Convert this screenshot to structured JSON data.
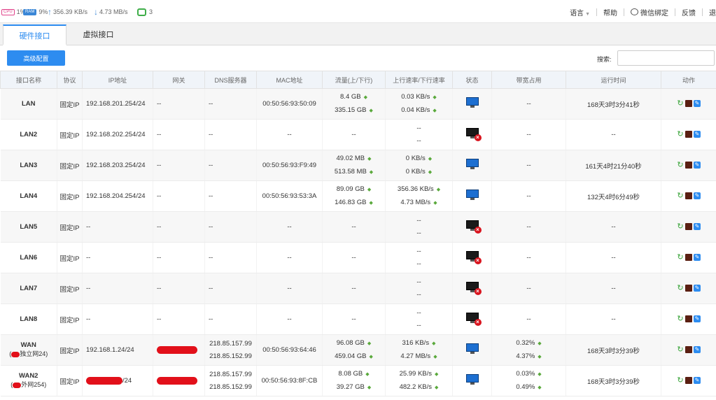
{
  "status": {
    "cpu_chip": "CPU",
    "cpu": "1%",
    "ram_chip": "RAM",
    "ram": "9%",
    "upload": "356.39 KB/s",
    "download": "4.73 MB/s",
    "devices": "3"
  },
  "toplinks": {
    "language": "语言",
    "help": "帮助",
    "wechat": "微信绑定",
    "feedback": "反馈",
    "logout": "退"
  },
  "tabs": {
    "hardware": "硬件接口",
    "virtual": "虚拟接口"
  },
  "toolbar": {
    "advanced": "高级配置",
    "search_label": "搜索:",
    "search_value": ""
  },
  "columns": [
    "接口名称",
    "协议",
    "IP地址",
    "网关",
    "DNS服务器",
    "MAC地址",
    "流量(上/下行)",
    "上行速率/下行速率",
    "状态",
    "带宽占用",
    "运行时间",
    "动作"
  ],
  "rows": [
    {
      "name": "LAN",
      "proto": "固定IP",
      "ip": "192.168.201.254/24",
      "gw": "--",
      "dns1": "--",
      "dns2": "",
      "mac": "00:50:56:93:50:09",
      "t_up": "8.4 GB",
      "t_down": "335.15 GB",
      "r_up": "0.03 KB/s",
      "r_down": "0.04 KB/s",
      "status": "on",
      "bw": "--",
      "bw2": "",
      "uptime": "168天3时3分41秒"
    },
    {
      "name": "LAN2",
      "proto": "固定IP",
      "ip": "192.168.202.254/24",
      "gw": "--",
      "dns1": "--",
      "dns2": "",
      "mac": "--",
      "t_up": "--",
      "t_down": "",
      "r_up": "--",
      "r_down": "--",
      "status": "off",
      "bw": "--",
      "bw2": "",
      "uptime": "--"
    },
    {
      "name": "LAN3",
      "proto": "固定IP",
      "ip": "192.168.203.254/24",
      "gw": "--",
      "dns1": "--",
      "dns2": "",
      "mac": "00:50:56:93:F9:49",
      "t_up": "49.02 MB",
      "t_down": "513.58 MB",
      "r_up": "0 KB/s",
      "r_down": "0 KB/s",
      "status": "on",
      "bw": "--",
      "bw2": "",
      "uptime": "161天4时21分40秒"
    },
    {
      "name": "LAN4",
      "proto": "固定IP",
      "ip": "192.168.204.254/24",
      "gw": "--",
      "dns1": "--",
      "dns2": "",
      "mac": "00:50:56:93:53:3A",
      "t_up": "89.09 GB",
      "t_down": "146.83 GB",
      "r_up": "356.36 KB/s",
      "r_down": "4.73 MB/s",
      "status": "on",
      "bw": "--",
      "bw2": "",
      "uptime": "132天4时6分49秒"
    },
    {
      "name": "LAN5",
      "proto": "固定IP",
      "ip": "--",
      "gw": "--",
      "dns1": "--",
      "dns2": "",
      "mac": "--",
      "t_up": "--",
      "t_down": "",
      "r_up": "--",
      "r_down": "--",
      "status": "off",
      "bw": "--",
      "bw2": "",
      "uptime": "--"
    },
    {
      "name": "LAN6",
      "proto": "固定IP",
      "ip": "--",
      "gw": "--",
      "dns1": "--",
      "dns2": "",
      "mac": "--",
      "t_up": "--",
      "t_down": "",
      "r_up": "--",
      "r_down": "--",
      "status": "off",
      "bw": "--",
      "bw2": "",
      "uptime": "--"
    },
    {
      "name": "LAN7",
      "proto": "固定IP",
      "ip": "--",
      "gw": "--",
      "dns1": "--",
      "dns2": "",
      "mac": "--",
      "t_up": "--",
      "t_down": "",
      "r_up": "--",
      "r_down": "--",
      "status": "off",
      "bw": "--",
      "bw2": "",
      "uptime": "--"
    },
    {
      "name": "LAN8",
      "proto": "固定IP",
      "ip": "--",
      "gw": "--",
      "dns1": "--",
      "dns2": "",
      "mac": "--",
      "t_up": "--",
      "t_down": "",
      "r_up": "--",
      "r_down": "--",
      "status": "off",
      "bw": "--",
      "bw2": "",
      "uptime": "--"
    },
    {
      "name": "WAN",
      "sub": "独立网24)",
      "proto": "固定IP",
      "ip": "192.168.1.24/24",
      "gw": "",
      "dns1": "218.85.157.99",
      "dns2": "218.85.152.99",
      "mac": "00:50:56:93:64:46",
      "t_up": "96.08 GB",
      "t_down": "459.04 GB",
      "r_up": "316 KB/s",
      "r_down": "4.27 MB/s",
      "status": "on",
      "bw": "0.32%",
      "bw2": "4.37%",
      "uptime": "168天3时3分39秒"
    },
    {
      "name": "WAN2",
      "sub": "外网254)",
      "proto": "固定IP",
      "ip": "/24",
      "gw": "",
      "dns1": "218.85.157.99",
      "dns2": "218.85.152.99",
      "mac": "00:50:56:93:8F:CB",
      "t_up": "8.08 GB",
      "t_down": "39.27 GB",
      "r_up": "25.99 KB/s",
      "r_down": "482.2 KB/s",
      "status": "on",
      "bw": "0.03%",
      "bw2": "0.49%",
      "uptime": "168天3时3分39秒"
    }
  ]
}
